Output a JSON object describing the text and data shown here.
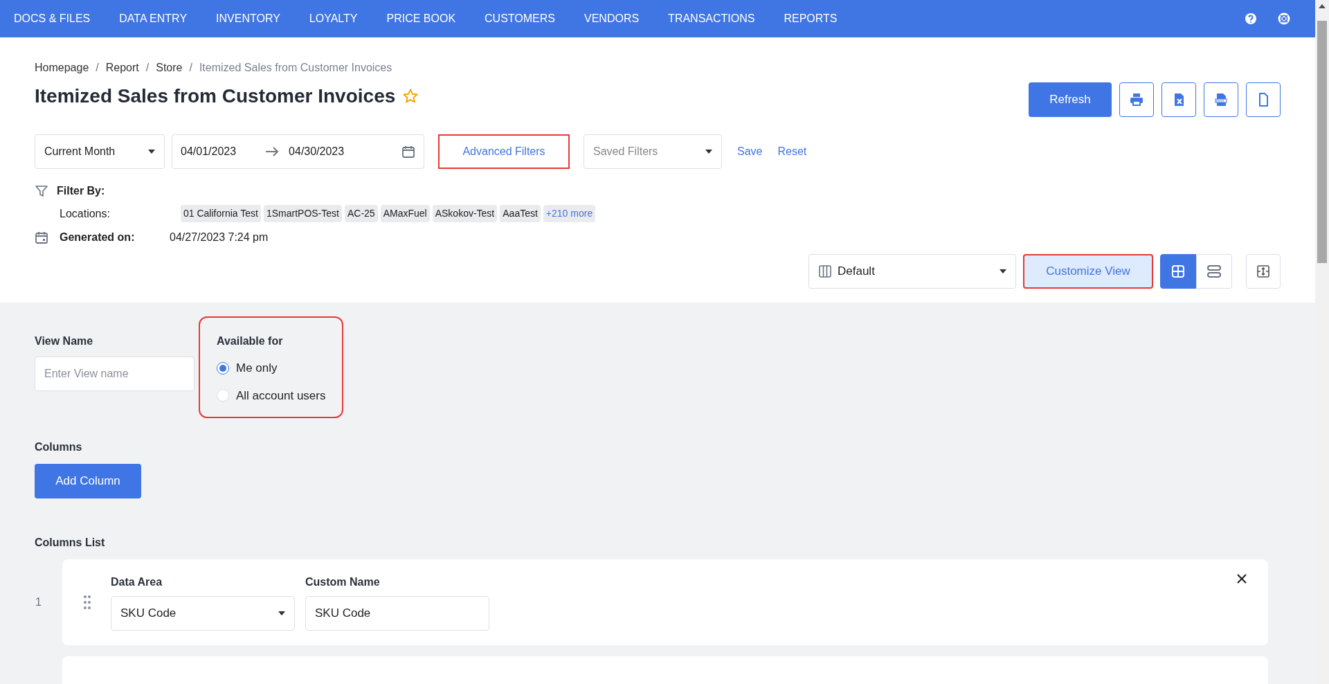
{
  "nav": {
    "items": [
      {
        "label": "DOCS & FILES"
      },
      {
        "label": "DATA ENTRY"
      },
      {
        "label": "INVENTORY"
      },
      {
        "label": "LOYALTY"
      },
      {
        "label": "PRICE BOOK"
      },
      {
        "label": "CUSTOMERS"
      },
      {
        "label": "VENDORS"
      },
      {
        "label": "TRANSACTIONS"
      },
      {
        "label": "REPORTS"
      }
    ]
  },
  "breadcrumb": [
    {
      "kind": "link",
      "label": "Homepage"
    },
    {
      "kind": "separator",
      "label": "/"
    },
    {
      "kind": "link",
      "label": "Report"
    },
    {
      "kind": "separator",
      "label": "/"
    },
    {
      "kind": "link",
      "label": "Store"
    },
    {
      "kind": "separator",
      "label": "/"
    },
    {
      "kind": "current",
      "label": "Itemized Sales from Customer Invoices"
    }
  ],
  "title": "Itemized Sales from Customer Invoices",
  "actions": {
    "refresh": "Refresh"
  },
  "filters": {
    "period": "Current Month",
    "date_from": "04/01/2023",
    "date_to": "04/30/2023",
    "advanced": {
      "label": "Advanced Filters",
      "highlighted": true
    },
    "saved_placeholder": "Saved Filters",
    "save": "Save",
    "reset": "Reset"
  },
  "filter_by": {
    "label": "Filter By:",
    "locations_label": "Locations:",
    "locations": [
      "01 California Test",
      "1SmartPOS-Test",
      "AC-25",
      "AMaxFuel",
      "ASkokov-Test",
      "AaaTest"
    ],
    "more": "+210 more",
    "generated_label": "Generated on:",
    "generated_value": "04/27/2023 7:24 pm"
  },
  "view_bar": {
    "view": "Default",
    "customize": {
      "label": "Customize View",
      "highlighted": true
    },
    "layouts": [
      {
        "kind": "grid",
        "selected": true
      },
      {
        "kind": "rows",
        "selected": false
      }
    ]
  },
  "customize": {
    "view_name_label": "View Name",
    "view_name_placeholder": "Enter View name",
    "available": {
      "label": "Available for",
      "highlighted": true,
      "options": [
        {
          "label": "Me only",
          "selected": true
        },
        {
          "label": "All account users",
          "selected": false
        }
      ]
    },
    "columns_label": "Columns",
    "add_column": "Add Column",
    "columns_list_label": "Columns List",
    "columns": [
      {
        "index": "1",
        "data_area_label": "Data Area",
        "data_area": "SKU Code",
        "custom_name_label": "Custom Name",
        "custom_name": "SKU Code"
      }
    ]
  }
}
